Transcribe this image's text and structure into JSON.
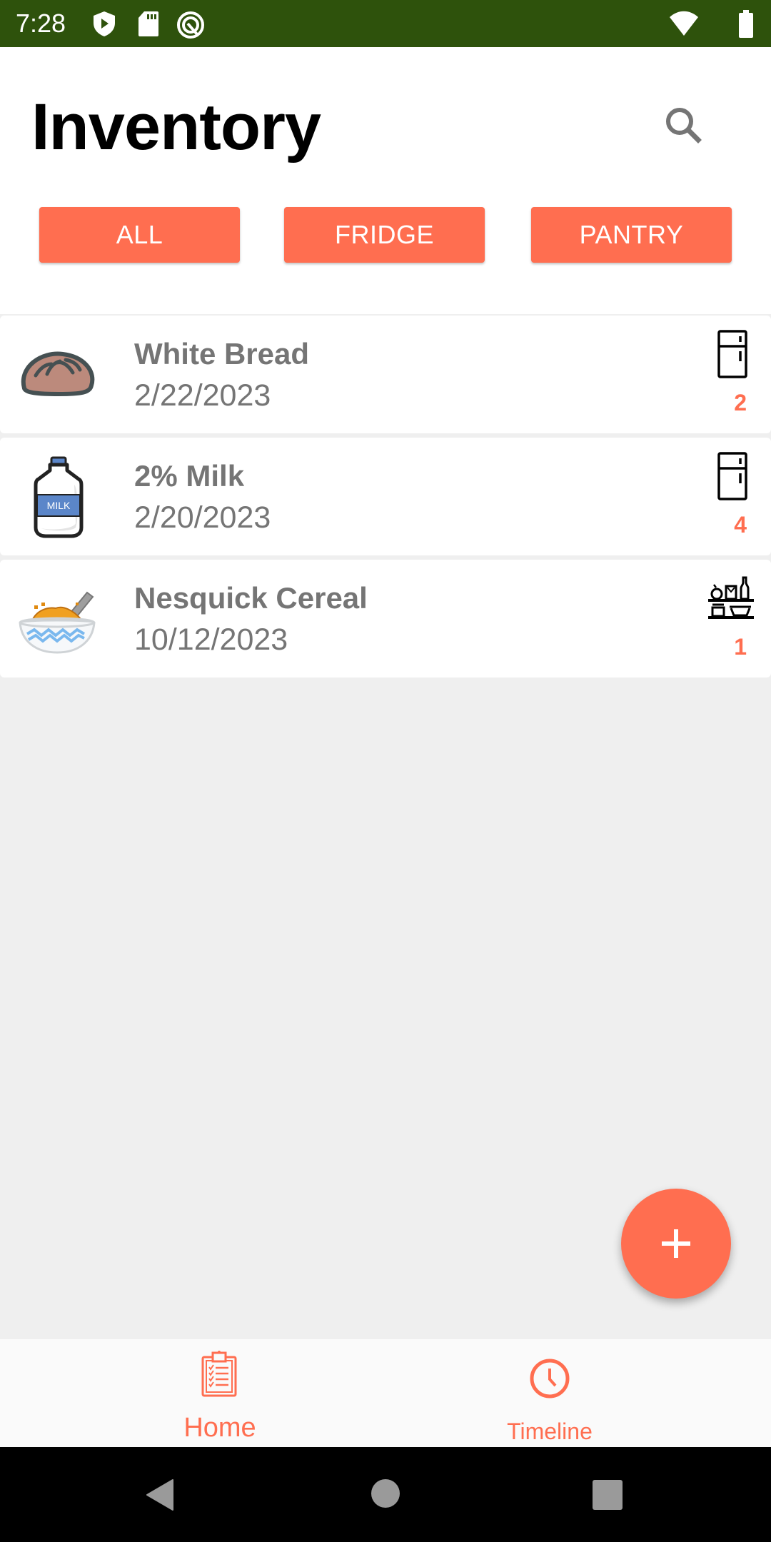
{
  "status_bar": {
    "time": "7:28",
    "icons": [
      "play-protect-icon",
      "sd-card-icon",
      "sync-icon",
      "wifi-icon",
      "battery-icon"
    ]
  },
  "header": {
    "title": "Inventory",
    "search_icon": "search-icon"
  },
  "filters": [
    {
      "label": "ALL"
    },
    {
      "label": "FRIDGE"
    },
    {
      "label": "PANTRY"
    }
  ],
  "items": [
    {
      "name": "White Bread",
      "date": "2/22/2023",
      "thumb_icon": "bread-icon",
      "location_icon": "fridge-icon",
      "quantity": "2"
    },
    {
      "name": "2% Milk",
      "date": "2/20/2023",
      "thumb_icon": "milk-icon",
      "thumb_label": "MILK",
      "location_icon": "fridge-icon",
      "quantity": "4"
    },
    {
      "name": "Nesquick Cereal",
      "date": "10/12/2023",
      "thumb_icon": "cereal-bowl-icon",
      "location_icon": "pantry-shelf-icon",
      "quantity": "1"
    }
  ],
  "fab": {
    "icon": "plus-icon"
  },
  "bottom_nav": {
    "items": [
      {
        "label": "Home",
        "icon": "clipboard-icon",
        "active": true
      },
      {
        "label": "Timeline",
        "icon": "clock-icon",
        "active": false
      }
    ]
  },
  "colors": {
    "accent": "#ff6e50",
    "status_bar": "#2e520c",
    "text_secondary": "#757575",
    "background": "#efefef"
  }
}
